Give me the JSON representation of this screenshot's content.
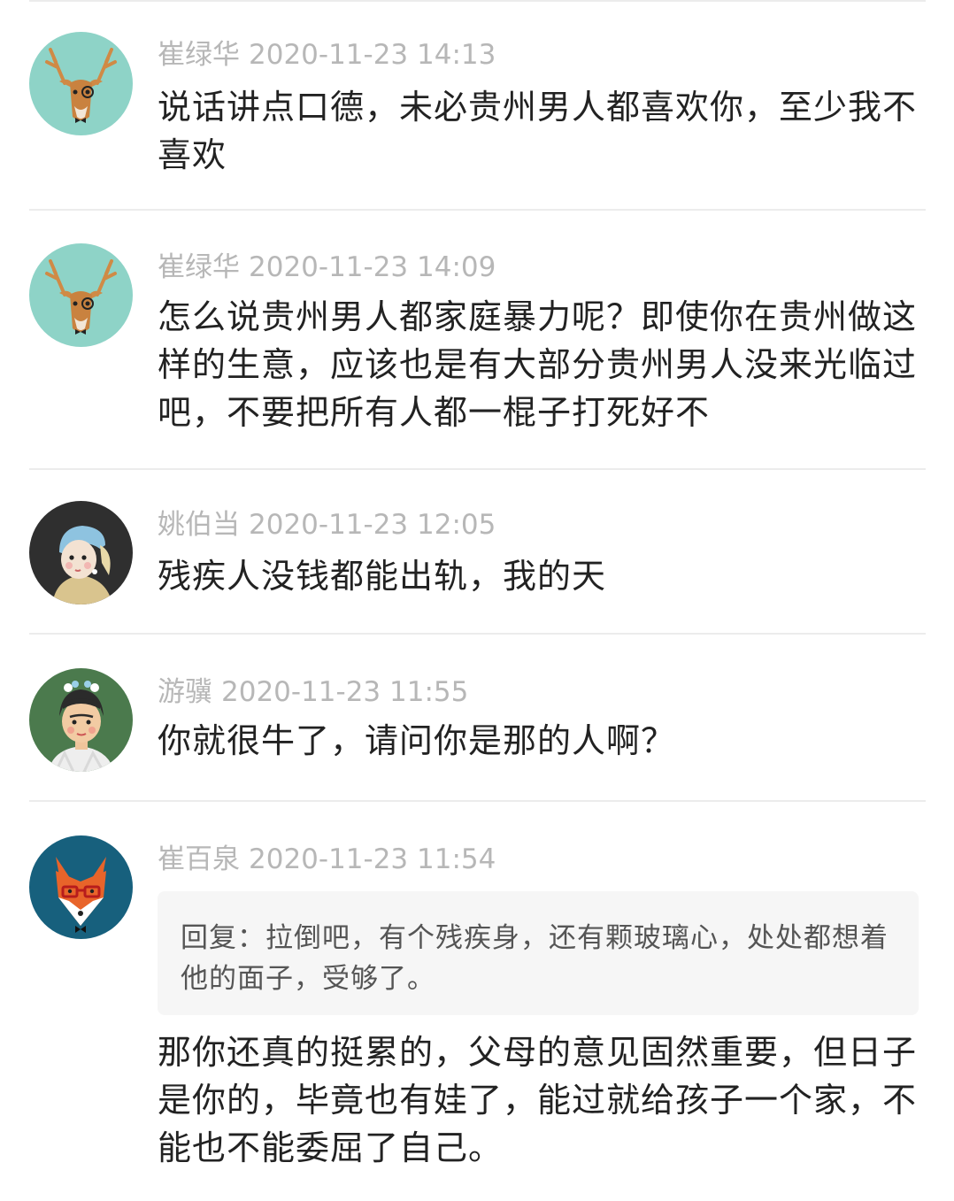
{
  "comments": [
    {
      "author": "崔绿华",
      "time": "2020-11-23 14:13",
      "avatar_icon": "deer-monocle-icon",
      "content": "说话讲点口德，未必贵州男人都喜欢你，至少我不喜欢"
    },
    {
      "author": "崔绿华",
      "time": "2020-11-23 14:09",
      "avatar_icon": "deer-monocle-icon",
      "content": "怎么说贵州男人都家庭暴力呢？即使你在贵州做这样的生意，应该也是有大部分贵州男人没来光临过吧，不要把所有人都一棍子打死好不"
    },
    {
      "author": "姚伯当",
      "time": "2020-11-23 12:05",
      "avatar_icon": "girl-pearl-earring-icon",
      "content": "残疾人没钱都能出轨，我的天"
    },
    {
      "author": "游骥",
      "time": "2020-11-23 11:55",
      "avatar_icon": "frida-portrait-icon",
      "content": "你就很牛了，请问你是那的人啊？"
    },
    {
      "author": "崔百泉",
      "time": "2020-11-23 11:54",
      "avatar_icon": "fox-glasses-icon",
      "reply_quote": "回复：拉倒吧，有个残疾身，还有颗玻璃心，处处都想着他的面子，受够了。",
      "content": "那你还真的挺累的，父母的意见固然重要，但日子是你的，毕竟也有娃了，能过就给孩子一个家，不能也不能委屈了自己。"
    }
  ],
  "colors": {
    "meta_text": "#b7b7b7",
    "body_text": "#222222",
    "divider": "#ececec",
    "quote_bg": "#f6f6f6"
  }
}
